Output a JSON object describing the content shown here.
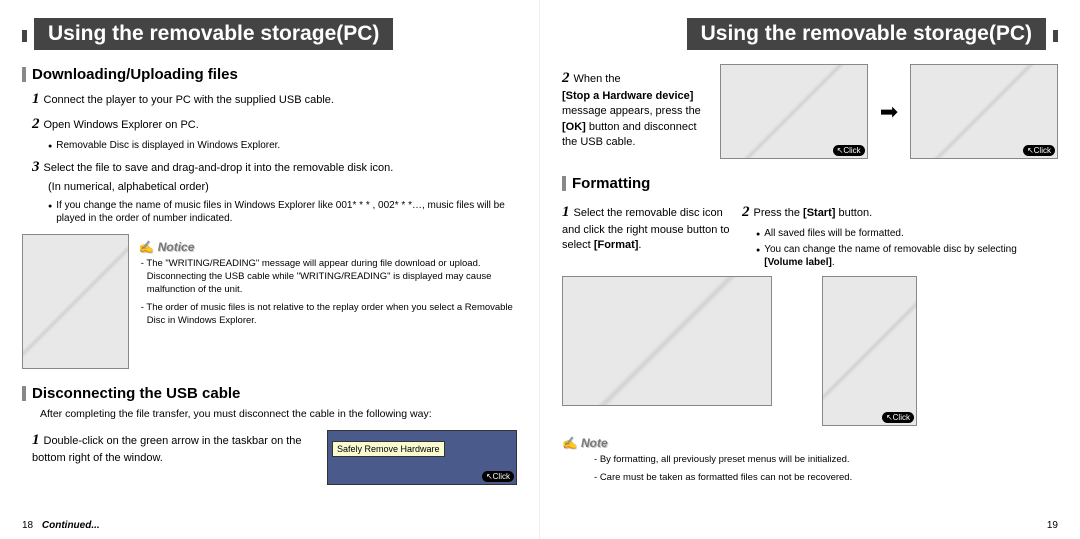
{
  "left": {
    "title": "Using the removable storage(PC)",
    "section1": "Downloading/Uploading files",
    "s1_step1": "Connect the player to your PC with the supplied USB cable.",
    "s1_step2": "Open Windows Explorer on PC.",
    "s1_step2_sub": "Removable Disc is displayed in Windows Explorer.",
    "s1_step3": "Select the file to save and drag-and-drop it into the removable disk icon.",
    "s1_step3_b": "(In numerical, alphabetical order)",
    "s1_step3_sub": "If you change the name of music files in Windows Explorer like 001* * * , 002* * *…, music files will be played in the order of number indicated.",
    "notice_label": "Notice",
    "notice1": "The \"WRITING/READING\" message will appear during file download or upload. Disconnecting the USB cable while \"WRITING/READING\" is displayed may cause malfunction of the unit.",
    "notice2": "The order of music files is not relative to the replay order when you select a Removable Disc in Windows Explorer.",
    "section2": "Disconnecting the USB cable",
    "s2_intro": "After completing the file transfer, you must disconnect the cable in the following way:",
    "s2_step1": "Double-click on the green arrow in the taskbar on the bottom right of the window.",
    "srh_label": "Safely Remove Hardware",
    "click": "Click",
    "page_num": "18",
    "continued": "Continued..."
  },
  "right": {
    "title": "Using the removable storage(PC)",
    "s1_step2_a": "When the",
    "s1_step2_b": "[Stop a Hardware device]",
    "s1_step2_c": "message appears, press the",
    "s1_step2_d": "[OK]",
    "s1_step2_e": "button and disconnect the USB cable.",
    "section2": "Formatting",
    "f_step1": "Select the removable disc icon and click the right mouse button to select",
    "f_step1_b": "[Format]",
    "f_step2": "Press the",
    "f_step2_b": "[Start]",
    "f_step2_c": "button.",
    "f_sub1": "All saved files will be formatted.",
    "f_sub2": "You can change the name of removable disc by selecting",
    "f_sub2_b": "[Volume label]",
    "note_label": "Note",
    "note1": "By formatting, all previously preset menus will be initialized.",
    "note2": "Care must be taken as formatted files can not be recovered.",
    "click": "Click",
    "page_num": "19"
  }
}
